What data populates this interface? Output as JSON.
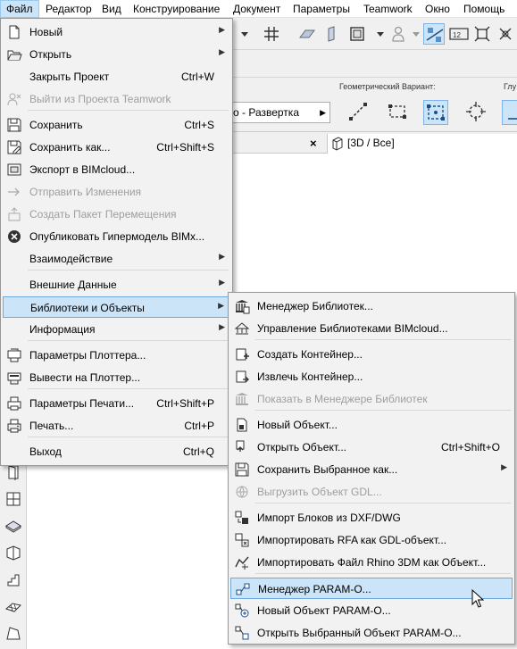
{
  "menubar": {
    "items": [
      "Файл",
      "Редактор",
      "Вид",
      "Конструирование",
      "Документ",
      "Параметры",
      "Teamwork",
      "Окно",
      "Помощь"
    ]
  },
  "infobox": {
    "geometry_label": "Геометрический Вариант:",
    "glu_label": "Глу",
    "mode_value": "о - Развертка"
  },
  "tab": {
    "close": "×",
    "label": "[3D / Все]"
  },
  "file_menu": {
    "items": [
      {
        "label": "Новый",
        "shortcut": "",
        "submenu": true,
        "enabled": true,
        "icon": "new-document-icon"
      },
      {
        "label": "Открыть",
        "shortcut": "",
        "submenu": true,
        "enabled": true,
        "icon": "open-folder-icon"
      },
      {
        "label": "Закрыть Проект",
        "shortcut": "Ctrl+W",
        "submenu": false,
        "enabled": true,
        "icon": ""
      },
      {
        "label": "Выйти из Проекта Teamwork",
        "shortcut": "",
        "submenu": false,
        "enabled": false,
        "icon": "teamwork-leave-icon"
      },
      {
        "label": "Сохранить",
        "shortcut": "Ctrl+S",
        "submenu": false,
        "enabled": true,
        "icon": "save-icon"
      },
      {
        "label": "Сохранить как...",
        "shortcut": "Ctrl+Shift+S",
        "submenu": false,
        "enabled": true,
        "icon": "save-as-icon"
      },
      {
        "label": "Экспорт в BIMcloud...",
        "shortcut": "",
        "submenu": false,
        "enabled": true,
        "icon": "export-bimcloud-icon"
      },
      {
        "label": "Отправить Изменения",
        "shortcut": "",
        "submenu": false,
        "enabled": false,
        "icon": "send-changes-icon"
      },
      {
        "label": "Создать Пакет Перемещения",
        "shortcut": "",
        "submenu": false,
        "enabled": false,
        "icon": "move-package-icon"
      },
      {
        "label": "Опубликовать Гипермодель BIMx...",
        "shortcut": "",
        "submenu": false,
        "enabled": true,
        "icon": "bimx-icon"
      },
      {
        "label": "Взаимодействие",
        "shortcut": "",
        "submenu": true,
        "enabled": true,
        "icon": ""
      },
      {
        "label": "Внешние Данные",
        "shortcut": "",
        "submenu": true,
        "enabled": true,
        "icon": ""
      },
      {
        "label": "Библиотеки и Объекты",
        "shortcut": "",
        "submenu": true,
        "enabled": true,
        "icon": ""
      },
      {
        "label": "Информация",
        "shortcut": "",
        "submenu": true,
        "enabled": true,
        "icon": ""
      },
      {
        "label": "Параметры Плоттера...",
        "shortcut": "",
        "submenu": false,
        "enabled": true,
        "icon": "plotter-setup-icon"
      },
      {
        "label": "Вывести на Плоттер...",
        "shortcut": "",
        "submenu": false,
        "enabled": true,
        "icon": "plot-icon"
      },
      {
        "label": "Параметры Печати...",
        "shortcut": "Ctrl+Shift+P",
        "submenu": false,
        "enabled": true,
        "icon": "print-setup-icon"
      },
      {
        "label": "Печать...",
        "shortcut": "Ctrl+P",
        "submenu": false,
        "enabled": true,
        "icon": "print-icon"
      },
      {
        "label": "Выход",
        "shortcut": "Ctrl+Q",
        "submenu": false,
        "enabled": true,
        "icon": ""
      }
    ]
  },
  "libraries_menu": {
    "items": [
      {
        "label": "Менеджер Библиотек...",
        "shortcut": "",
        "submenu": false,
        "enabled": true,
        "icon": "library-manager-icon"
      },
      {
        "label": "Управление Библиотеками BIMcloud...",
        "shortcut": "",
        "submenu": false,
        "enabled": true,
        "icon": "bimcloud-libraries-icon"
      },
      {
        "label": "Создать Контейнер...",
        "shortcut": "",
        "submenu": false,
        "enabled": true,
        "icon": "create-container-icon"
      },
      {
        "label": "Извлечь Контейнер...",
        "shortcut": "",
        "submenu": false,
        "enabled": true,
        "icon": "extract-container-icon"
      },
      {
        "label": "Показать в Менеджере Библиотек",
        "shortcut": "",
        "submenu": false,
        "enabled": false,
        "icon": "show-in-library-icon"
      },
      {
        "label": "Новый Объект...",
        "shortcut": "",
        "submenu": false,
        "enabled": true,
        "icon": "new-object-icon"
      },
      {
        "label": "Открыть Объект...",
        "shortcut": "Ctrl+Shift+O",
        "submenu": false,
        "enabled": true,
        "icon": "open-object-icon"
      },
      {
        "label": "Сохранить Выбранное как...",
        "shortcut": "",
        "submenu": true,
        "enabled": true,
        "icon": "save-selection-icon"
      },
      {
        "label": "Выгрузить Объект GDL...",
        "shortcut": "",
        "submenu": false,
        "enabled": false,
        "icon": "unload-gdl-icon"
      },
      {
        "label": "Импорт Блоков из DXF/DWG",
        "shortcut": "",
        "submenu": false,
        "enabled": true,
        "icon": "import-dxf-icon"
      },
      {
        "label": "Импортировать RFA как GDL-объект...",
        "shortcut": "",
        "submenu": false,
        "enabled": true,
        "icon": "import-rfa-icon"
      },
      {
        "label": "Импортировать Файл Rhino 3DM как Объект...",
        "shortcut": "",
        "submenu": false,
        "enabled": true,
        "icon": "import-rhino-icon"
      },
      {
        "label": "Менеджер PARAM-O...",
        "shortcut": "",
        "submenu": false,
        "enabled": true,
        "icon": "param-o-manager-icon"
      },
      {
        "label": "Новый Объект PARAM-O...",
        "shortcut": "",
        "submenu": false,
        "enabled": true,
        "icon": "param-o-new-icon"
      },
      {
        "label": "Открыть Выбранный Объект PARAM-O...",
        "shortcut": "",
        "submenu": false,
        "enabled": true,
        "icon": "param-o-open-icon"
      }
    ]
  },
  "colors": {
    "highlight": "#cce4f7",
    "highlight_border": "#6fa8dc",
    "disabled_text": "#9e9e9e",
    "menu_bg": "#f2f2f2"
  }
}
